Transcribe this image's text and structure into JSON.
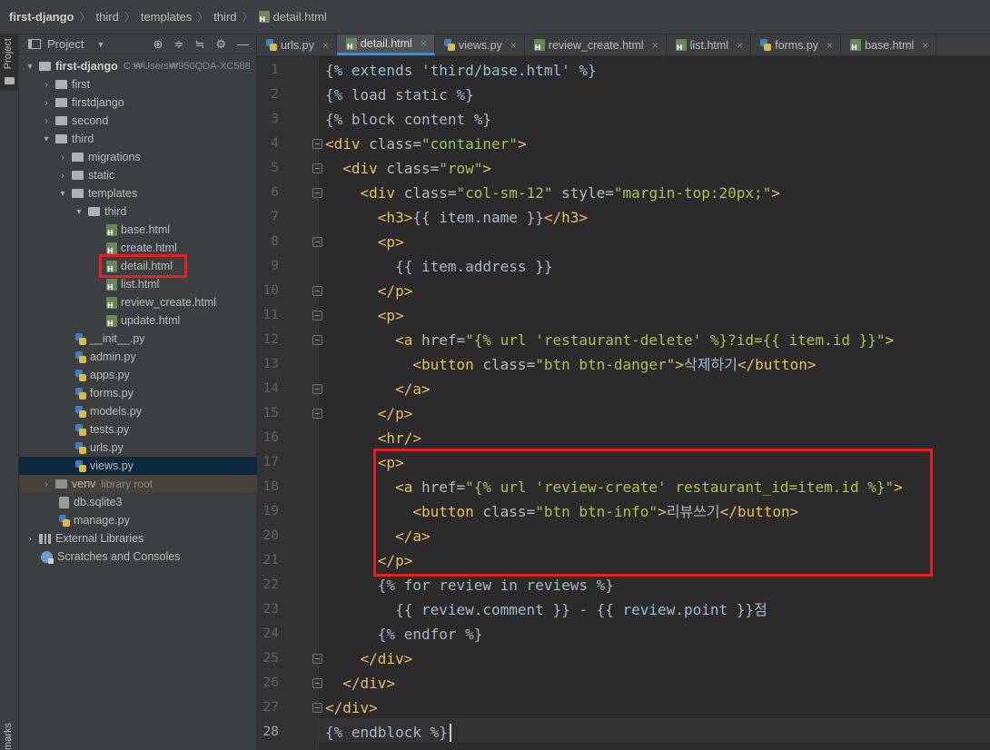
{
  "breadcrumb": [
    "first-django",
    "third",
    "templates",
    "third",
    "detail.html"
  ],
  "toolstrip": {
    "project_label": "Project",
    "bookmarks_label": "marks"
  },
  "project_panel": {
    "title": "Project",
    "tool_icons": [
      "locate-icon",
      "expand-all-icon",
      "collapse-all-icon",
      "gear-icon",
      "minimize-icon"
    ]
  },
  "tree": [
    {
      "label": "first-django",
      "hint": "C:₩Users₩950QDA-XC588",
      "kind": "folder",
      "expanded": true
    },
    {
      "label": "first",
      "kind": "folder"
    },
    {
      "label": "firstdjango",
      "kind": "folder"
    },
    {
      "label": "second",
      "kind": "folder"
    },
    {
      "label": "third",
      "kind": "folder",
      "expanded": true
    },
    {
      "label": "migrations",
      "kind": "folder"
    },
    {
      "label": "static",
      "kind": "folder"
    },
    {
      "label": "templates",
      "kind": "folder",
      "expanded": true
    },
    {
      "label": "third",
      "kind": "folder",
      "expanded": true
    },
    {
      "label": "base.html",
      "kind": "html"
    },
    {
      "label": "create.html",
      "kind": "html"
    },
    {
      "label": "detail.html",
      "kind": "html",
      "highlighted": true
    },
    {
      "label": "list.html",
      "kind": "html"
    },
    {
      "label": "review_create.html",
      "kind": "html"
    },
    {
      "label": "update.html",
      "kind": "html"
    },
    {
      "label": "__init__.py",
      "kind": "py"
    },
    {
      "label": "admin.py",
      "kind": "py"
    },
    {
      "label": "apps.py",
      "kind": "py"
    },
    {
      "label": "forms.py",
      "kind": "py"
    },
    {
      "label": "models.py",
      "kind": "py"
    },
    {
      "label": "tests.py",
      "kind": "py"
    },
    {
      "label": "urls.py",
      "kind": "py"
    },
    {
      "label": "views.py",
      "kind": "py",
      "selected": true
    },
    {
      "label": "venv",
      "hint": "library root",
      "kind": "folder"
    },
    {
      "label": "db.sqlite3",
      "kind": "db"
    },
    {
      "label": "manage.py",
      "kind": "py"
    },
    {
      "label": "External Libraries",
      "kind": "lib"
    },
    {
      "label": "Scratches and Consoles",
      "kind": "scratch"
    }
  ],
  "tabs": [
    {
      "label": "urls.py",
      "kind": "py"
    },
    {
      "label": "detail.html",
      "kind": "html",
      "active": true
    },
    {
      "label": "views.py",
      "kind": "py"
    },
    {
      "label": "review_create.html",
      "kind": "html"
    },
    {
      "label": "list.html",
      "kind": "html"
    },
    {
      "label": "forms.py",
      "kind": "py"
    },
    {
      "label": "base.html",
      "kind": "html"
    }
  ],
  "tab_close_glyph": "×",
  "line_numbers": [
    "1",
    "2",
    "3",
    "4",
    "5",
    "6",
    "7",
    "8",
    "9",
    "10",
    "11",
    "12",
    "13",
    "14",
    "15",
    "16",
    "17",
    "18",
    "19",
    "20",
    "21",
    "22",
    "23",
    "24",
    "25",
    "26",
    "27",
    "28"
  ],
  "code": [
    "{% extends 'third/base.html' %}",
    "{% load static %}",
    "{% block content %}",
    "<div class=\"container\">",
    "  <div class=\"row\">",
    "    <div class=\"col-sm-12\" style=\"margin-top:20px;\">",
    "      <h3>{{ item.name }}</h3>",
    "      <p>",
    "        {{ item.address }}",
    "      </p>",
    "      <p>",
    "        <a href=\"{% url 'restaurant-delete' %}?id={{ item.id }}\">",
    "          <button class=\"btn btn-danger\">삭제하기</button>",
    "        </a>",
    "      </p>",
    "      <hr/>",
    "      <p>",
    "        <a href=\"{% url 'review-create' restaurant_id=item.id %}\">",
    "          <button class=\"btn btn-info\">리뷰쓰기</button>",
    "        </a>",
    "      </p>",
    "      {% for review in reviews %}",
    "        {{ review.comment }} - {{ review.point }}점",
    "      {% endfor %}",
    "    </div>",
    "  </div>",
    "</div>",
    "{% endblock %}"
  ],
  "current_line": "28",
  "colors": {
    "tag": "#e8bf6a",
    "string": "#a5c25c",
    "plain": "#a9b7c6",
    "highlight_box": "#e3211f",
    "selection": "#0d293e"
  }
}
